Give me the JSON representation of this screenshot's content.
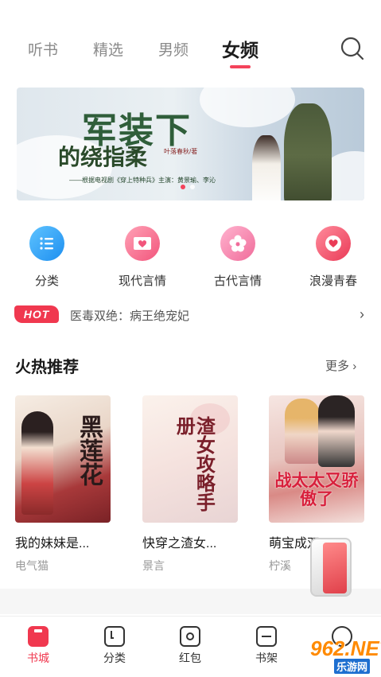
{
  "tabs": [
    {
      "label": "听书",
      "active": false
    },
    {
      "label": "精选",
      "active": false
    },
    {
      "label": "男频",
      "active": false
    },
    {
      "label": "女频",
      "active": true
    }
  ],
  "search": {
    "icon": "search-icon"
  },
  "banner": {
    "title": "军装下",
    "subtitle": "的绕指柔",
    "author": "叶落春秋/著",
    "credit": "——根据电视剧《穿上特种兵》主演：黄景瑜、李沁",
    "dots": 2,
    "active_dot": 0
  },
  "categories": [
    {
      "label": "分类",
      "icon": "list-icon",
      "color": "#2aa7f5"
    },
    {
      "label": "现代言情",
      "icon": "heart-envelope-icon",
      "color": "#f86a8a"
    },
    {
      "label": "古代言情",
      "icon": "flower-icon",
      "color": "#f582a8"
    },
    {
      "label": "浪漫青春",
      "icon": "heart-icon",
      "color": "#f45b72"
    }
  ],
  "hot": {
    "badge": "HOT",
    "text": "医毒双绝：病王绝宠妃"
  },
  "section": {
    "title": "火热推荐",
    "more": "更多"
  },
  "books": [
    {
      "title": "我的妹妹是...",
      "author": "电气猫",
      "cover_text": "黑莲花"
    },
    {
      "title": "快穿之渣女...",
      "author": "景言",
      "cover_text": "渣女攻略手册"
    },
    {
      "title": "萌宝成双：...",
      "author": "柠溪",
      "cover_text": "战太太又骄傲了"
    }
  ],
  "bottom_nav": [
    {
      "label": "书城",
      "active": true
    },
    {
      "label": "分类",
      "active": false
    },
    {
      "label": "红包",
      "active": false
    },
    {
      "label": "书架",
      "active": false
    }
  ],
  "watermark": {
    "text": "962.NET",
    "sub": "乐游网"
  },
  "colors": {
    "accent": "#f0384f"
  }
}
